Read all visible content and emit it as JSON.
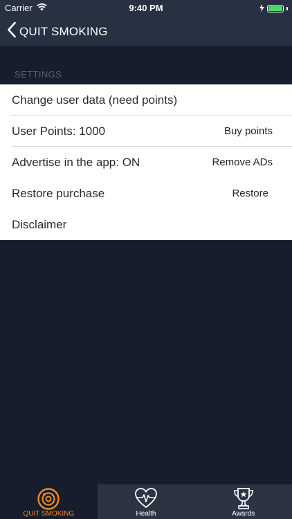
{
  "status_bar": {
    "carrier": "Carrier",
    "time": "9:40 PM",
    "battery_color": "#4cd964"
  },
  "nav": {
    "title": "QUIT SMOKING",
    "back_icon": "chevron-left-icon"
  },
  "settings": {
    "section_title": "SETTINGS",
    "rows": [
      {
        "label": "Change user data (need points)",
        "action": ""
      },
      {
        "label": "User Points: 1000",
        "action": "Buy points"
      },
      {
        "label": "Advertise in the app: ON",
        "action": "Remove ADs"
      },
      {
        "label": "Restore purchase",
        "action": "Restore"
      },
      {
        "label": "Disclaimer",
        "action": ""
      }
    ]
  },
  "tabs": [
    {
      "label": "QUIT SMOKING",
      "icon": "target-icon",
      "active": true
    },
    {
      "label": "Health",
      "icon": "heart-pulse-icon",
      "active": false
    },
    {
      "label": "Awards",
      "icon": "trophy-icon",
      "active": false
    }
  ],
  "colors": {
    "accent": "#f08a26",
    "background": "#161d2d",
    "bar": "#283142"
  }
}
